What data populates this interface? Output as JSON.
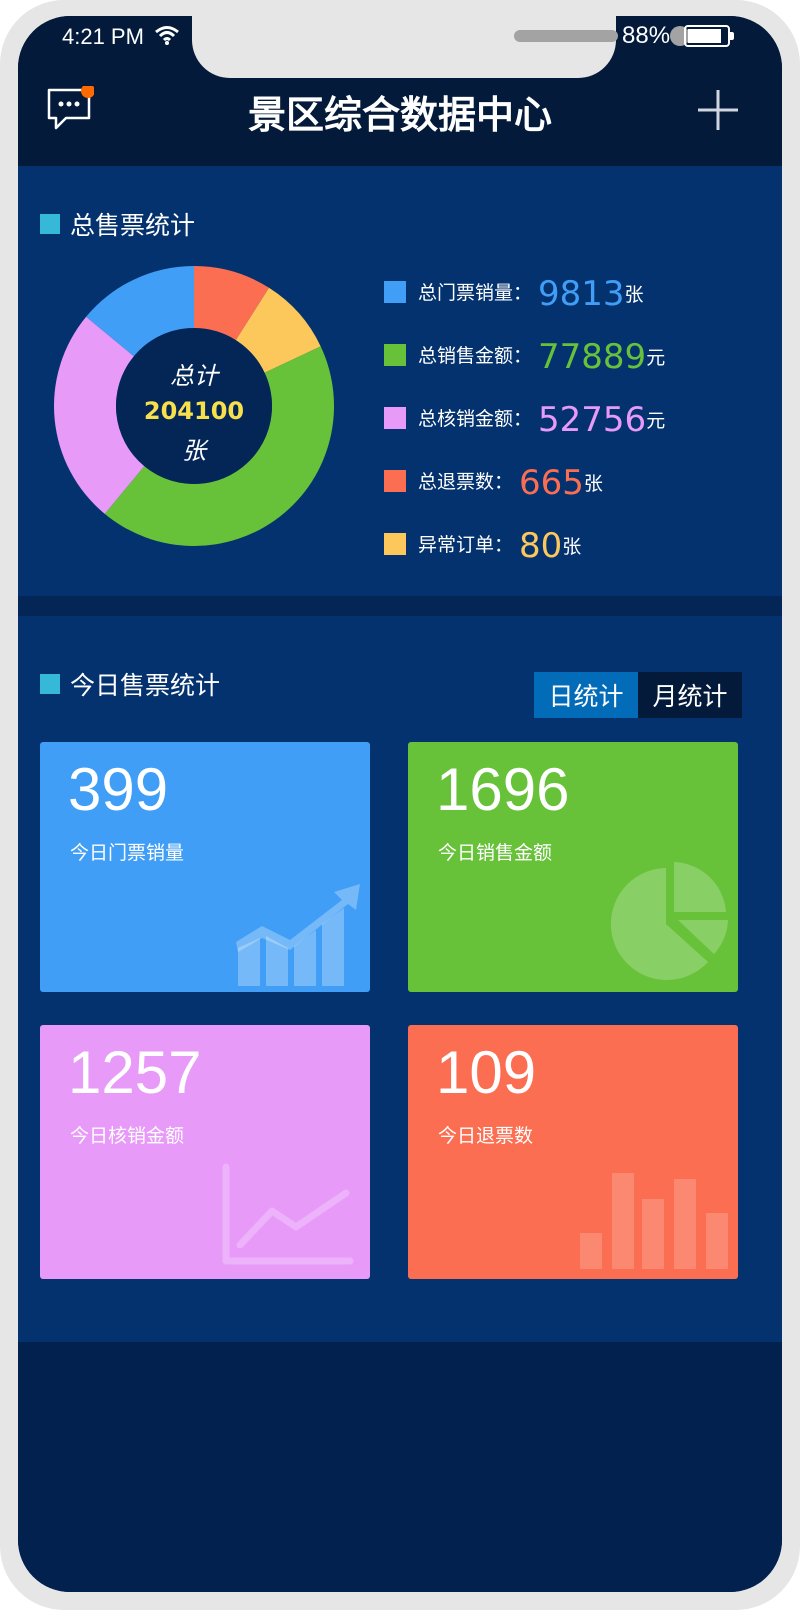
{
  "status": {
    "time": "4:21 PM",
    "battery": "88%"
  },
  "battery_level": 0.88,
  "header": {
    "title": "景区综合数据中心"
  },
  "total_section": {
    "title": "总售票统计",
    "center_label": "总计",
    "center_value": "204100",
    "center_unit": "张",
    "legend": [
      {
        "label": "总门票销量：",
        "value": "9813",
        "unit": "张",
        "color": "#409ef6"
      },
      {
        "label": "总销售金额：",
        "value": "77889",
        "unit": "元",
        "color": "#67c23a"
      },
      {
        "label": "总核销金额：",
        "value": "52756",
        "unit": "元",
        "color": "#e79af8"
      },
      {
        "label": "总退票数：",
        "value": "665",
        "unit": "张",
        "color": "#fb6e52"
      },
      {
        "label": "异常订单：",
        "value": "80",
        "unit": "张",
        "color": "#fcc75b"
      }
    ]
  },
  "chart_data": {
    "type": "pie",
    "donut": true,
    "slices": [
      {
        "label": "总门票销量",
        "fraction": 0.14,
        "color": "#409ef6"
      },
      {
        "label": "总销售金额",
        "fraction": 0.43,
        "color": "#67c23a"
      },
      {
        "label": "总核销金额",
        "fraction": 0.25,
        "color": "#e79af8"
      },
      {
        "label": "总退票数",
        "fraction": 0.09,
        "color": "#fb6e52"
      },
      {
        "label": "异常订单",
        "fraction": 0.09,
        "color": "#fcc75b"
      }
    ]
  },
  "today_section": {
    "title": "今日售票统计",
    "tabs": [
      {
        "label": "日统计",
        "active": true
      },
      {
        "label": "月统计",
        "active": false
      }
    ],
    "cards": [
      {
        "value": "399",
        "label": "今日门票销量",
        "color": "#409ef6",
        "icon": "trend-up-bars-icon"
      },
      {
        "value": "1696",
        "label": "今日销售金额",
        "color": "#67c23a",
        "icon": "pie-chart-icon"
      },
      {
        "value": "1257",
        "label": "今日核销金额",
        "color": "#e79af8",
        "icon": "line-chart-icon"
      },
      {
        "value": "109",
        "label": "今日退票数",
        "color": "#fb6e52",
        "icon": "bar-chart-icon"
      }
    ]
  }
}
